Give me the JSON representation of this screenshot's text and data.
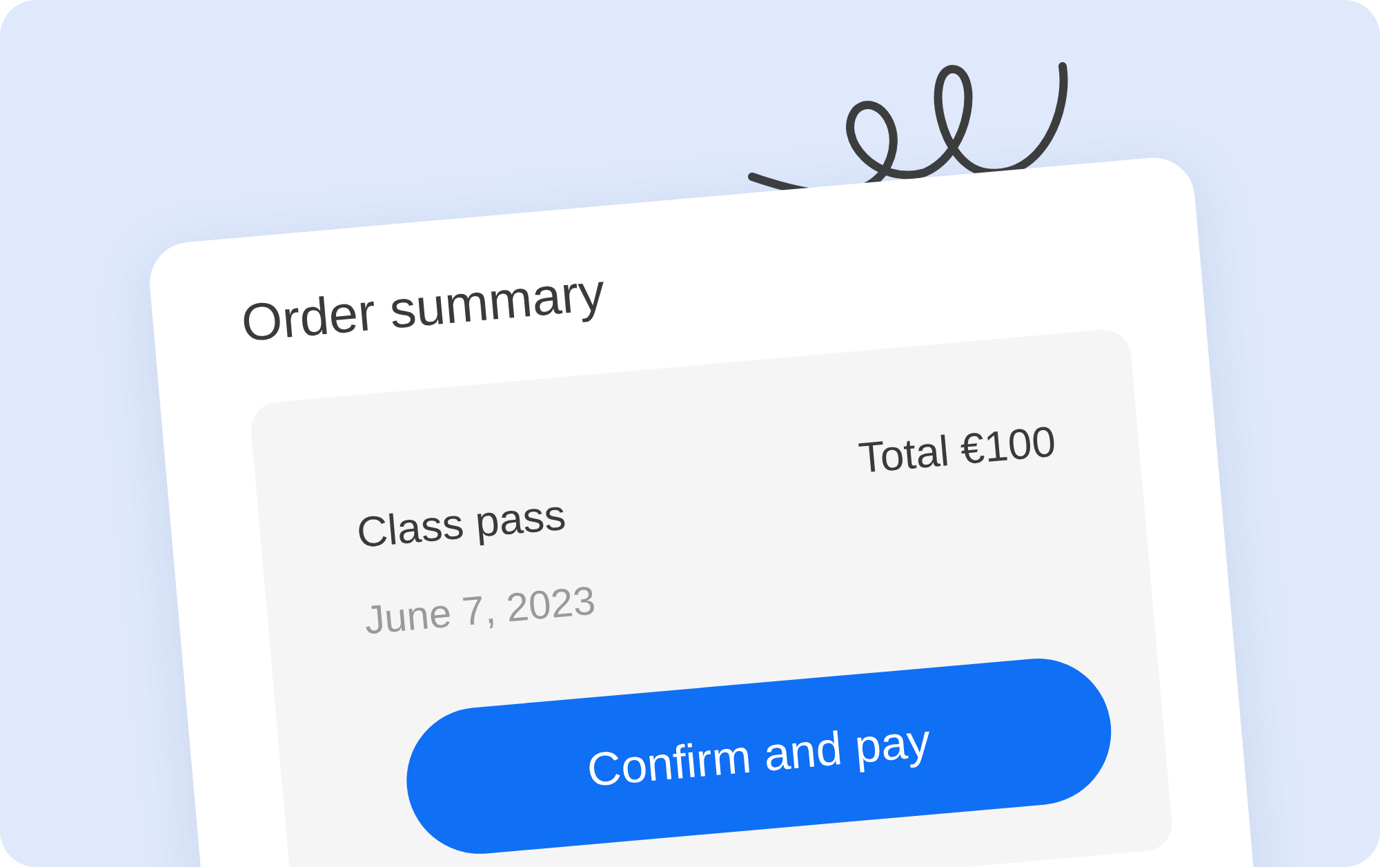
{
  "card": {
    "title": "Order summary",
    "item": {
      "name": "Class pass",
      "date": "June 7, 2023",
      "total": "Total €100"
    },
    "button": "Confirm and pay"
  }
}
